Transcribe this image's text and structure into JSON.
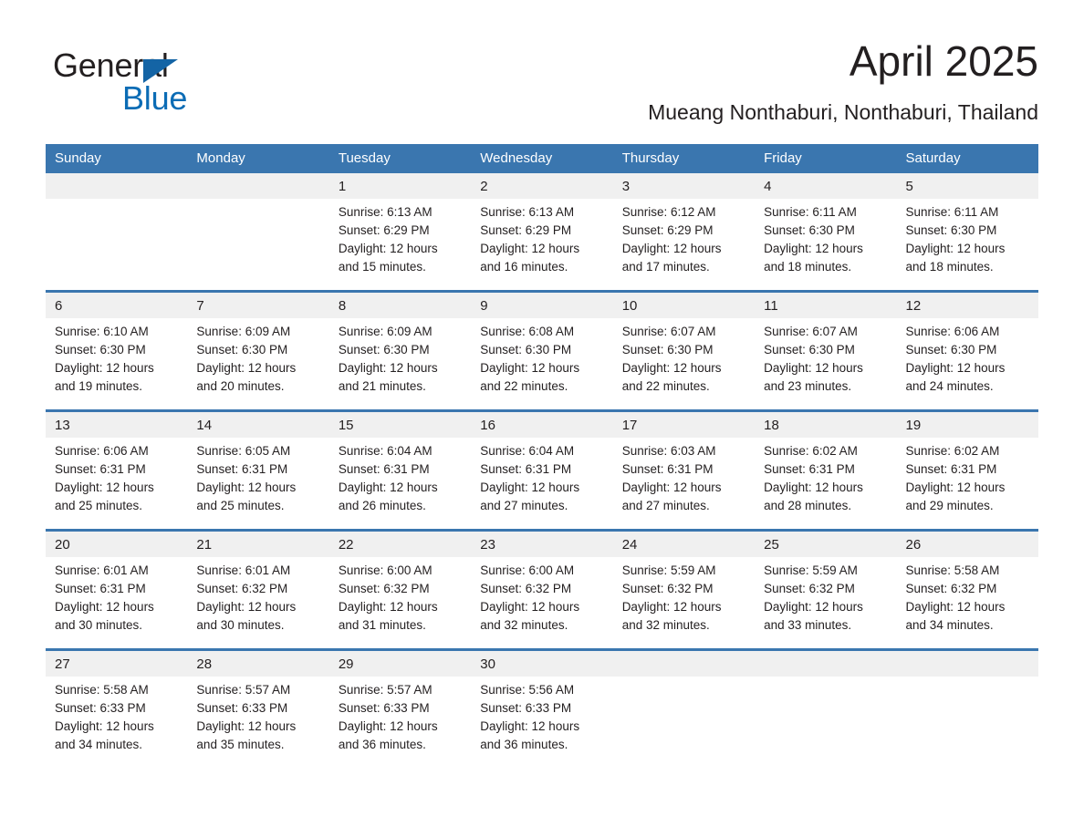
{
  "brand": {
    "logo_text_1": "General",
    "logo_text_2": "Blue",
    "logo_icon": "blue-triangle-icon",
    "color_black": "#231f20",
    "color_blue": "#0b6cb5"
  },
  "header": {
    "title": "April 2025",
    "location": "Mueang Nonthaburi, Nonthaburi, Thailand"
  },
  "theme": {
    "header_bg": "#3a76af",
    "header_text": "#ffffff",
    "daynum_bg": "#f0f0f0",
    "cell_bg": "#ffffff",
    "rule_color": "#3a76af"
  },
  "calendar": {
    "weekdays": [
      "Sunday",
      "Monday",
      "Tuesday",
      "Wednesday",
      "Thursday",
      "Friday",
      "Saturday"
    ],
    "weeks": [
      {
        "days": [
          {
            "num": "",
            "lines": [
              "",
              "",
              "",
              ""
            ]
          },
          {
            "num": "",
            "lines": [
              "",
              "",
              "",
              ""
            ]
          },
          {
            "num": "1",
            "lines": [
              "Sunrise: 6:13 AM",
              "Sunset: 6:29 PM",
              "Daylight: 12 hours",
              "and 15 minutes."
            ]
          },
          {
            "num": "2",
            "lines": [
              "Sunrise: 6:13 AM",
              "Sunset: 6:29 PM",
              "Daylight: 12 hours",
              "and 16 minutes."
            ]
          },
          {
            "num": "3",
            "lines": [
              "Sunrise: 6:12 AM",
              "Sunset: 6:29 PM",
              "Daylight: 12 hours",
              "and 17 minutes."
            ]
          },
          {
            "num": "4",
            "lines": [
              "Sunrise: 6:11 AM",
              "Sunset: 6:30 PM",
              "Daylight: 12 hours",
              "and 18 minutes."
            ]
          },
          {
            "num": "5",
            "lines": [
              "Sunrise: 6:11 AM",
              "Sunset: 6:30 PM",
              "Daylight: 12 hours",
              "and 18 minutes."
            ]
          }
        ]
      },
      {
        "days": [
          {
            "num": "6",
            "lines": [
              "Sunrise: 6:10 AM",
              "Sunset: 6:30 PM",
              "Daylight: 12 hours",
              "and 19 minutes."
            ]
          },
          {
            "num": "7",
            "lines": [
              "Sunrise: 6:09 AM",
              "Sunset: 6:30 PM",
              "Daylight: 12 hours",
              "and 20 minutes."
            ]
          },
          {
            "num": "8",
            "lines": [
              "Sunrise: 6:09 AM",
              "Sunset: 6:30 PM",
              "Daylight: 12 hours",
              "and 21 minutes."
            ]
          },
          {
            "num": "9",
            "lines": [
              "Sunrise: 6:08 AM",
              "Sunset: 6:30 PM",
              "Daylight: 12 hours",
              "and 22 minutes."
            ]
          },
          {
            "num": "10",
            "lines": [
              "Sunrise: 6:07 AM",
              "Sunset: 6:30 PM",
              "Daylight: 12 hours",
              "and 22 minutes."
            ]
          },
          {
            "num": "11",
            "lines": [
              "Sunrise: 6:07 AM",
              "Sunset: 6:30 PM",
              "Daylight: 12 hours",
              "and 23 minutes."
            ]
          },
          {
            "num": "12",
            "lines": [
              "Sunrise: 6:06 AM",
              "Sunset: 6:30 PM",
              "Daylight: 12 hours",
              "and 24 minutes."
            ]
          }
        ]
      },
      {
        "days": [
          {
            "num": "13",
            "lines": [
              "Sunrise: 6:06 AM",
              "Sunset: 6:31 PM",
              "Daylight: 12 hours",
              "and 25 minutes."
            ]
          },
          {
            "num": "14",
            "lines": [
              "Sunrise: 6:05 AM",
              "Sunset: 6:31 PM",
              "Daylight: 12 hours",
              "and 25 minutes."
            ]
          },
          {
            "num": "15",
            "lines": [
              "Sunrise: 6:04 AM",
              "Sunset: 6:31 PM",
              "Daylight: 12 hours",
              "and 26 minutes."
            ]
          },
          {
            "num": "16",
            "lines": [
              "Sunrise: 6:04 AM",
              "Sunset: 6:31 PM",
              "Daylight: 12 hours",
              "and 27 minutes."
            ]
          },
          {
            "num": "17",
            "lines": [
              "Sunrise: 6:03 AM",
              "Sunset: 6:31 PM",
              "Daylight: 12 hours",
              "and 27 minutes."
            ]
          },
          {
            "num": "18",
            "lines": [
              "Sunrise: 6:02 AM",
              "Sunset: 6:31 PM",
              "Daylight: 12 hours",
              "and 28 minutes."
            ]
          },
          {
            "num": "19",
            "lines": [
              "Sunrise: 6:02 AM",
              "Sunset: 6:31 PM",
              "Daylight: 12 hours",
              "and 29 minutes."
            ]
          }
        ]
      },
      {
        "days": [
          {
            "num": "20",
            "lines": [
              "Sunrise: 6:01 AM",
              "Sunset: 6:31 PM",
              "Daylight: 12 hours",
              "and 30 minutes."
            ]
          },
          {
            "num": "21",
            "lines": [
              "Sunrise: 6:01 AM",
              "Sunset: 6:32 PM",
              "Daylight: 12 hours",
              "and 30 minutes."
            ]
          },
          {
            "num": "22",
            "lines": [
              "Sunrise: 6:00 AM",
              "Sunset: 6:32 PM",
              "Daylight: 12 hours",
              "and 31 minutes."
            ]
          },
          {
            "num": "23",
            "lines": [
              "Sunrise: 6:00 AM",
              "Sunset: 6:32 PM",
              "Daylight: 12 hours",
              "and 32 minutes."
            ]
          },
          {
            "num": "24",
            "lines": [
              "Sunrise: 5:59 AM",
              "Sunset: 6:32 PM",
              "Daylight: 12 hours",
              "and 32 minutes."
            ]
          },
          {
            "num": "25",
            "lines": [
              "Sunrise: 5:59 AM",
              "Sunset: 6:32 PM",
              "Daylight: 12 hours",
              "and 33 minutes."
            ]
          },
          {
            "num": "26",
            "lines": [
              "Sunrise: 5:58 AM",
              "Sunset: 6:32 PM",
              "Daylight: 12 hours",
              "and 34 minutes."
            ]
          }
        ]
      },
      {
        "days": [
          {
            "num": "27",
            "lines": [
              "Sunrise: 5:58 AM",
              "Sunset: 6:33 PM",
              "Daylight: 12 hours",
              "and 34 minutes."
            ]
          },
          {
            "num": "28",
            "lines": [
              "Sunrise: 5:57 AM",
              "Sunset: 6:33 PM",
              "Daylight: 12 hours",
              "and 35 minutes."
            ]
          },
          {
            "num": "29",
            "lines": [
              "Sunrise: 5:57 AM",
              "Sunset: 6:33 PM",
              "Daylight: 12 hours",
              "and 36 minutes."
            ]
          },
          {
            "num": "30",
            "lines": [
              "Sunrise: 5:56 AM",
              "Sunset: 6:33 PM",
              "Daylight: 12 hours",
              "and 36 minutes."
            ]
          },
          {
            "num": "",
            "lines": [
              "",
              "",
              "",
              ""
            ]
          },
          {
            "num": "",
            "lines": [
              "",
              "",
              "",
              ""
            ]
          },
          {
            "num": "",
            "lines": [
              "",
              "",
              "",
              ""
            ]
          }
        ]
      }
    ]
  }
}
